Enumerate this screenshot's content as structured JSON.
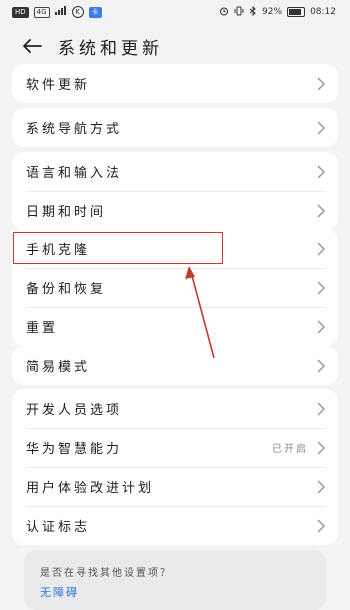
{
  "status_bar": {
    "network_tags": [
      "HD",
      "4G"
    ],
    "k_badge": "K",
    "blue_badge": "卡",
    "battery_percent": "92%",
    "time": "08:12"
  },
  "header": {
    "title": "系统和更新"
  },
  "groups": [
    {
      "rows": [
        {
          "label": "软件更新"
        }
      ]
    },
    {
      "rows": [
        {
          "label": "系统导航方式"
        }
      ]
    },
    {
      "rows": [
        {
          "label": "语言和输入法"
        },
        {
          "label": "日期和时间"
        }
      ]
    },
    {
      "rows": [
        {
          "label": "手机克隆"
        },
        {
          "label": "备份和恢复"
        },
        {
          "label": "重置"
        }
      ]
    },
    {
      "rows": [
        {
          "label": "简易模式"
        }
      ]
    },
    {
      "rows": [
        {
          "label": "开发人员选项"
        },
        {
          "label": "华为智慧能力",
          "value": "已开启"
        },
        {
          "label": "用户体验改进计划"
        },
        {
          "label": "认证标志"
        }
      ]
    }
  ],
  "suggest": {
    "question": "是否在寻找其他设置项？",
    "link": "无障碍"
  },
  "colors": {
    "highlight": "#c33a2e",
    "link": "#3c6fd8"
  }
}
